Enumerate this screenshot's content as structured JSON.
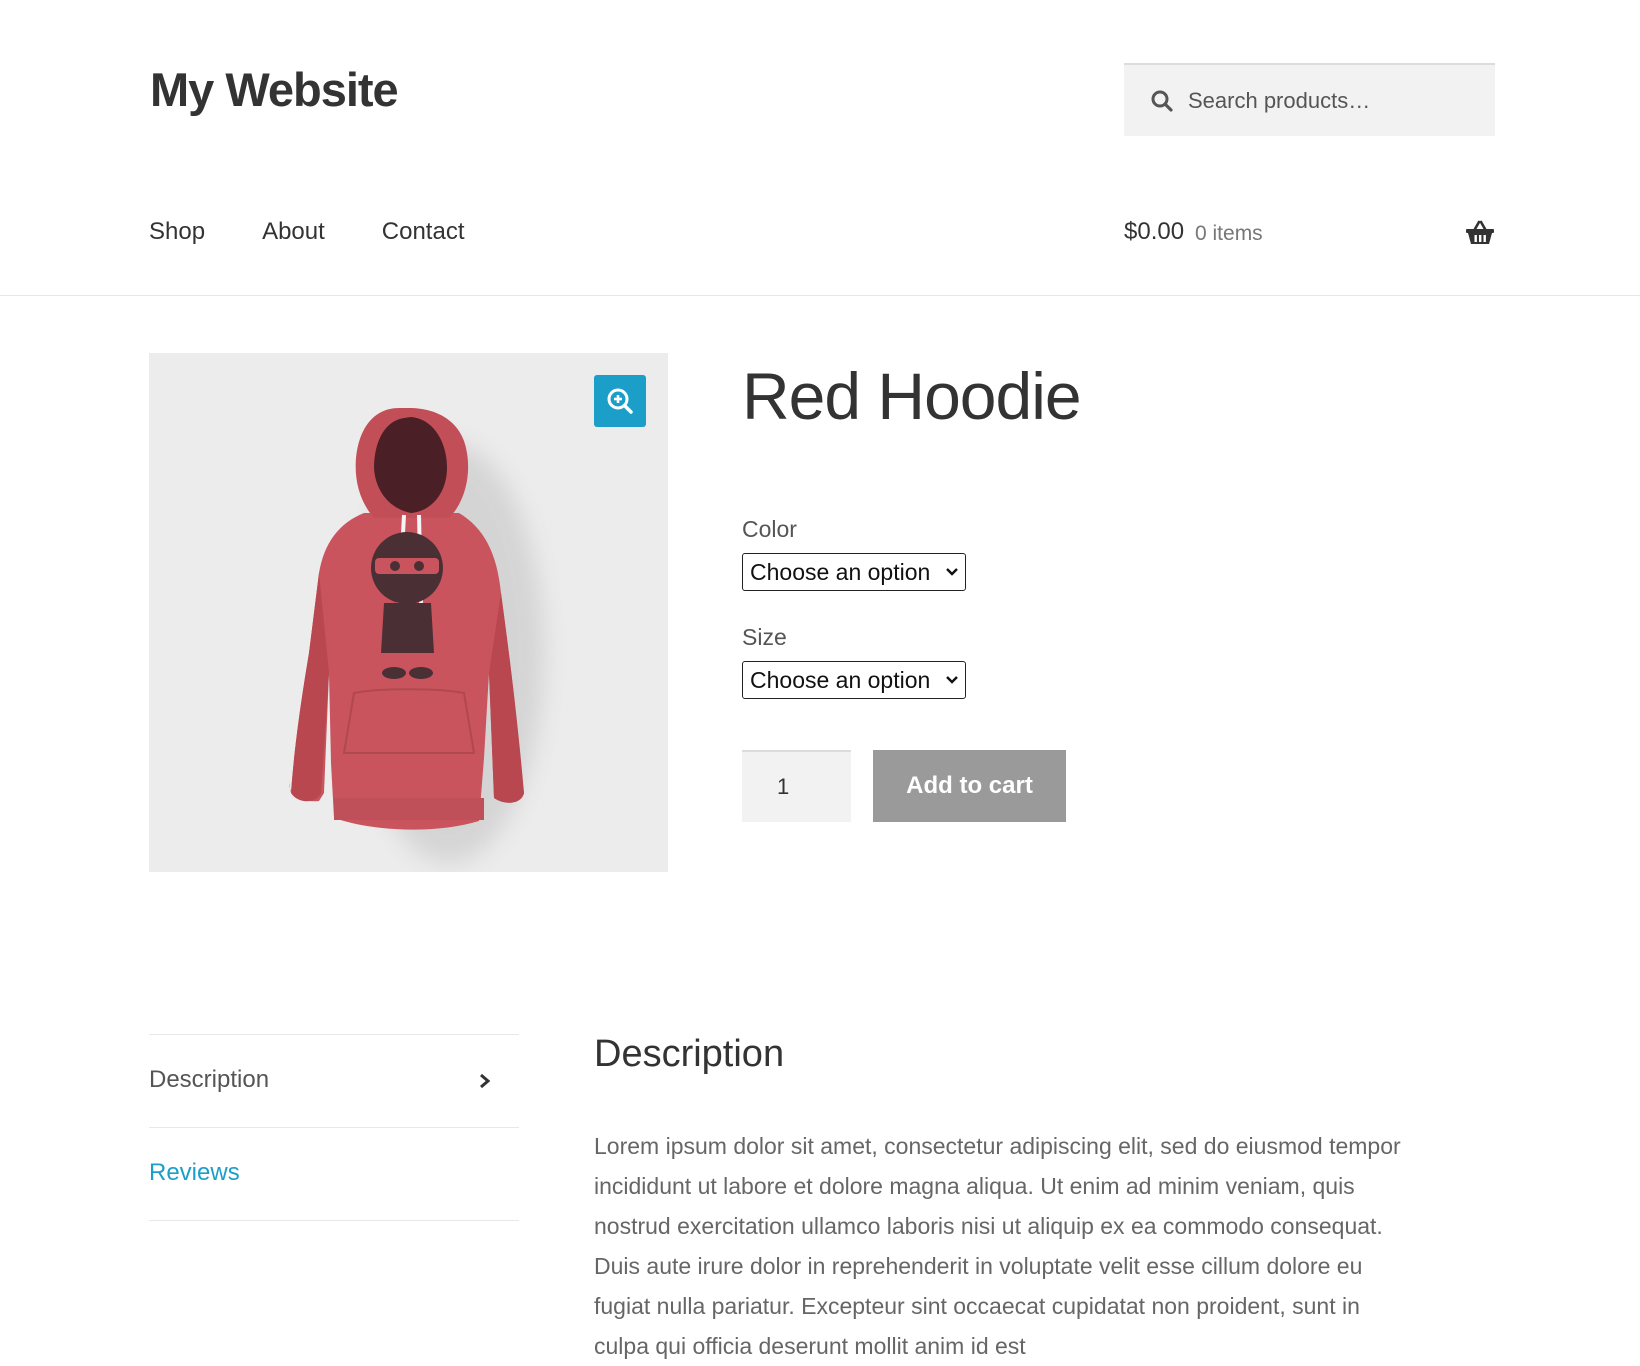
{
  "site": {
    "title": "My Website"
  },
  "search": {
    "placeholder": "Search products…"
  },
  "nav": {
    "items": [
      "Shop",
      "About",
      "Contact"
    ]
  },
  "cart": {
    "total": "$0.00",
    "count": "0 items"
  },
  "product": {
    "title": "Red Hoodie",
    "color_label": "Color",
    "color_value": "Choose an option",
    "size_label": "Size",
    "size_value": "Choose an option",
    "quantity": "1",
    "add_to_cart": "Add to cart",
    "hoodie_color": "#c9545e"
  },
  "tabs": {
    "description": "Description",
    "reviews": "Reviews"
  },
  "description": {
    "heading": "Description",
    "body": "Lorem ipsum dolor sit amet, consectetur adipiscing elit, sed do eiusmod tempor incididunt ut labore et dolore magna aliqua. Ut enim ad minim veniam, quis nostrud exercitation ullamco laboris nisi ut aliquip ex ea commodo consequat. Duis aute irure dolor in reprehenderit in voluptate velit esse cillum dolore eu fugiat nulla pariatur. Excepteur sint occaecat cupidatat non proident, sunt in culpa qui officia deserunt mollit anim id est"
  },
  "colors": {
    "accent": "#1b9fc9",
    "button_disabled": "#9a9a9a"
  },
  "icons": {
    "search": "search-icon",
    "cart": "basket-icon",
    "zoom": "zoom-in-icon",
    "tab_arrow": "chevron-right-icon"
  }
}
